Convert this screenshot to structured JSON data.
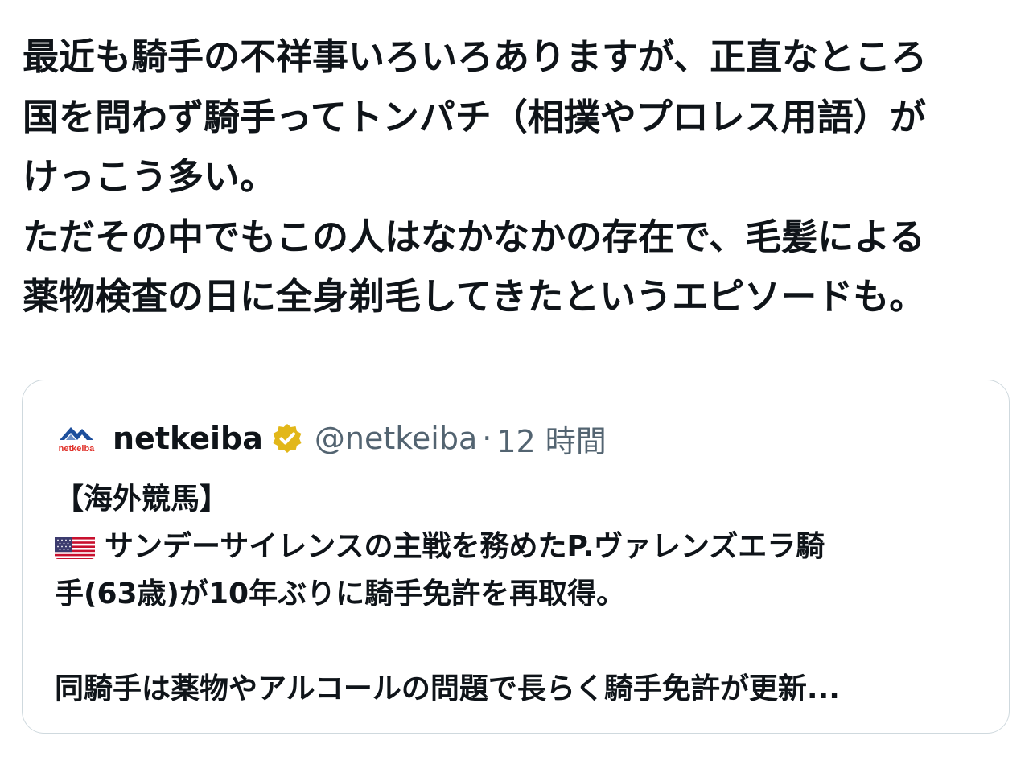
{
  "post": {
    "lines": [
      "最近も騎手の不祥事いろいろありますが、正直なところ",
      "国を問わず騎手ってトンパチ（相撲やプロレス用語）が",
      "けっこう多い。",
      "ただその中でもこの人はなかなかの存在で、毛髪による",
      "薬物検査の日に全身剃毛してきたというエピソードも。"
    ]
  },
  "quote": {
    "author_name": "netkeiba",
    "handle": "@netkeiba",
    "separator": "·",
    "time": "12 時間",
    "logo_text": "netkeiba",
    "verified_icon": "verified-gold-badge",
    "body": {
      "line1": "【海外競馬】",
      "line2_flag": "us-flag-icon",
      "line2": "サンデーサイレンスの主戦を務めたP.ヴァレンズエラ騎",
      "line3": "手(63歳)が10年ぶりに騎手免許を再取得。",
      "line5": "同騎手は薬物やアルコールの問題で長らく騎手免許が更新..."
    }
  },
  "colors": {
    "text": "#0f1419",
    "secondary": "#536471",
    "border": "#cfd9de",
    "verified_gold": "#e2b719",
    "logo_blue": "#1d4f9c",
    "logo_red": "#e0322b"
  }
}
